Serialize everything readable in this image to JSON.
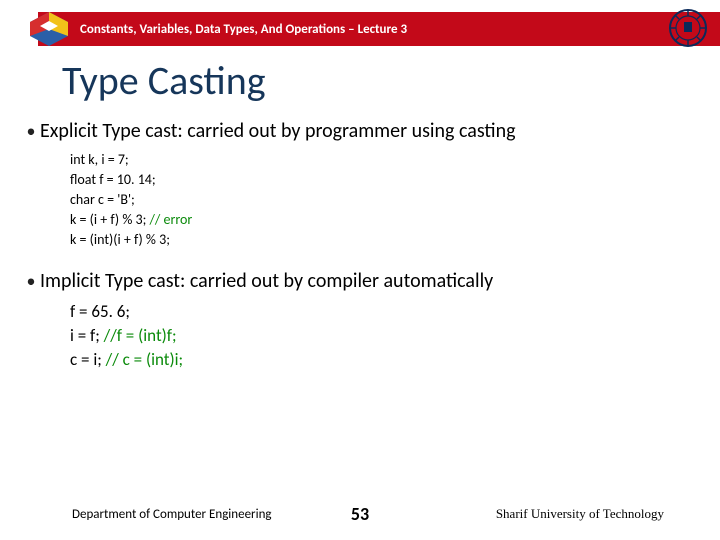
{
  "header": {
    "title": "Constants, Variables, Data Types, And Operations – Lecture 3"
  },
  "slide": {
    "title": "Type Casting"
  },
  "bullets": {
    "explicit": "Explicit Type cast: carried out by programmer using casting",
    "implicit": "Implicit Type cast: carried out by compiler automatically"
  },
  "code1": {
    "l1": "int  k,  i  =  7;",
    "l2": "float  f  = 10. 14;",
    "l3": "char c = 'B';",
    "l4a": "k = (i + f) % 3; ",
    "l4b": "// error",
    "l5": "k = (int)(i + f) % 3;"
  },
  "code2": {
    "l1": "f = 65. 6;",
    "l2a": "i = f;  ",
    "l2b": "//f = (int)f;",
    "l3a": "c = i;  ",
    "l3b": "// c = (int)i;"
  },
  "footer": {
    "left": "Department of Computer Engineering",
    "page": "53",
    "right": "Sharif University of Technology"
  }
}
